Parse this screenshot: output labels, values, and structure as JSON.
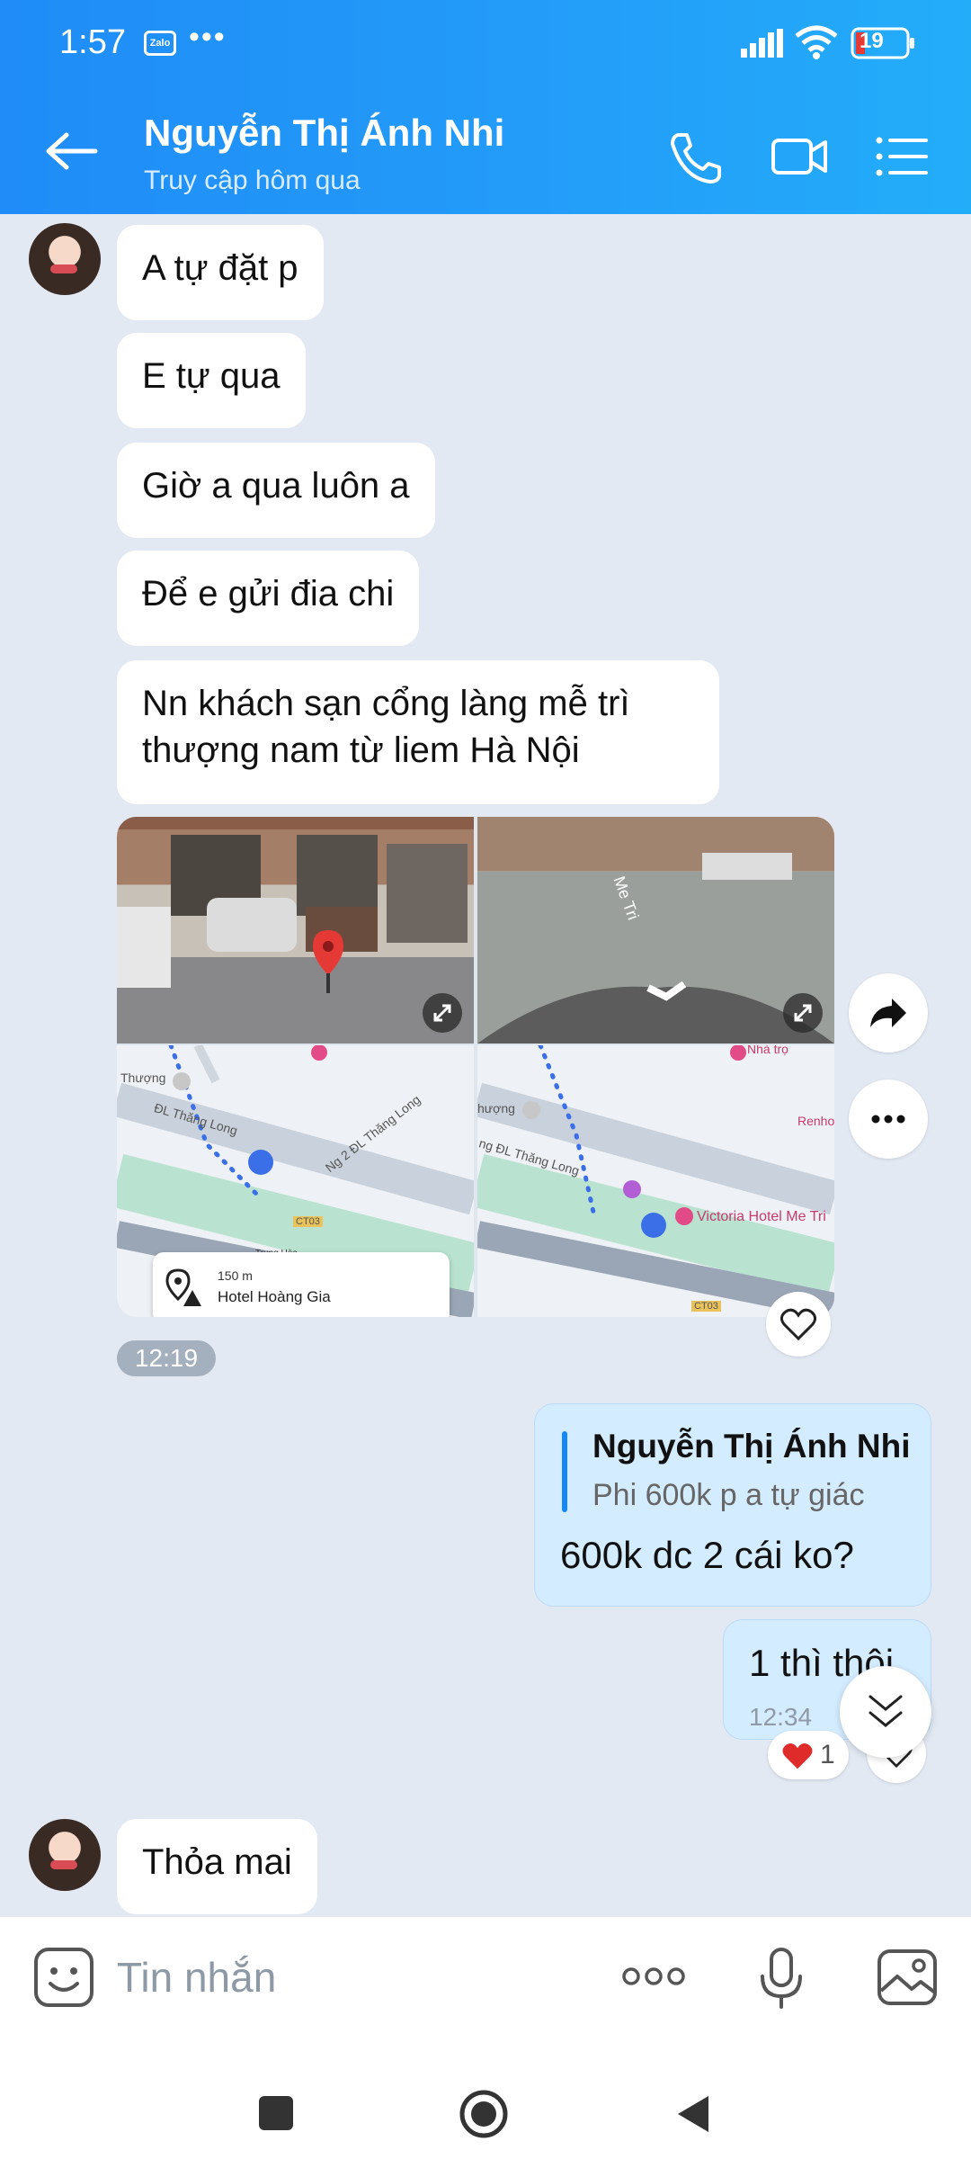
{
  "status_bar": {
    "time": "1:57",
    "app_badge": "Zalo",
    "dots": "•••",
    "battery": "19"
  },
  "header": {
    "contact_name": "Nguyễn Thị Ánh Nhi",
    "contact_status": "Truy cập hôm qua",
    "icons": [
      "back-arrow-icon",
      "phone-icon",
      "video-call-icon",
      "menu-list-icon"
    ]
  },
  "messages": {
    "m1": "A tự đặt p",
    "m2": "E tự qua",
    "m3": "Giờ a qua luôn a",
    "m4": "Để e gửi đia chi",
    "m5": "Nn khách sạn cổng làng mễ trì thượng nam từ liem Hà Nội",
    "map_card": {
      "left_map_labels": [
        "Thượng",
        "ĐL Thăng Long",
        "Ng 2 ĐL Thăng Long",
        "CT03",
        "Trung Hòa"
      ],
      "right_map_labels": [
        "Nhà trọ",
        "hượng",
        "ng ĐL Thăng Long",
        "Victoria Hotel Me Tri",
        "Renho",
        "CT03"
      ],
      "place_distance": "150 m",
      "place_name": "Hotel Hoàng Gia",
      "street_sign": "Me Tri"
    },
    "m5_time": "12:19",
    "reply": {
      "quote_name": "Nguyễn Thị Ánh Nhi",
      "quote_text": "Phi 600k p a tự giác",
      "text": "600k dc 2 cái ko?"
    },
    "m7": "1 thì thôi",
    "m7_time": "12:34",
    "m7_reaction": {
      "emoji": "heart",
      "count": "1"
    },
    "m8": "Thỏa mai"
  },
  "input_bar": {
    "placeholder": "Tin nhắn",
    "more": "ooo"
  },
  "colors": {
    "header_gradient_start": "#1f8cf7",
    "header_gradient_end": "#23adf9",
    "chat_bg": "#e2e9f3",
    "my_bubble": "#d4ecff",
    "accent": "#1688f5"
  }
}
